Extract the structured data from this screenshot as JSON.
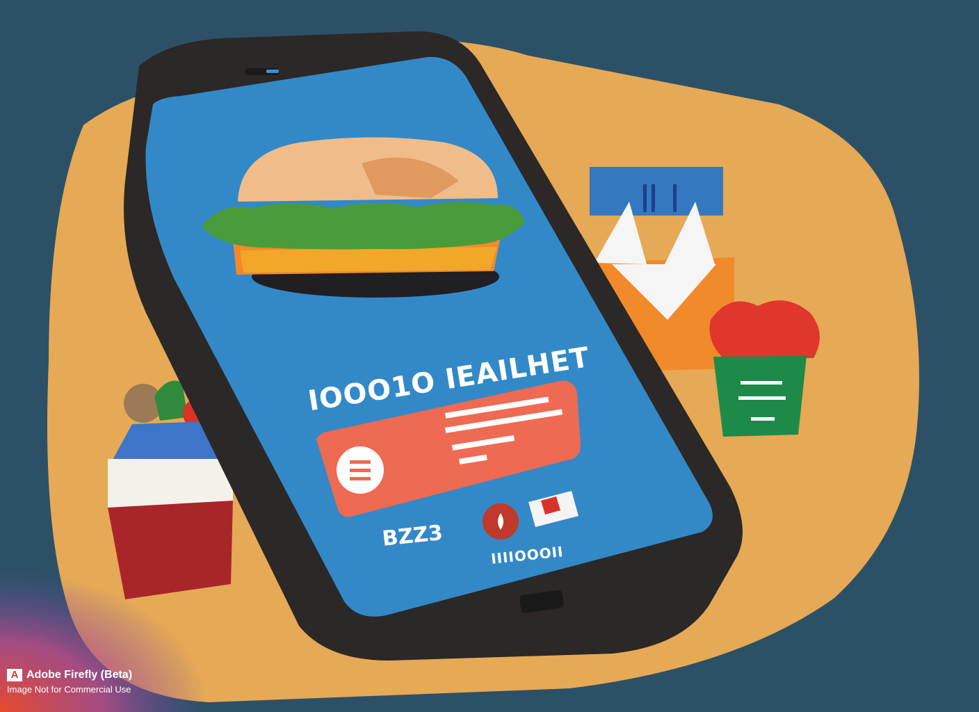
{
  "colors": {
    "background": "#2c5166",
    "table": "#e6a955",
    "phone_body": "#2b2827",
    "screen": "#3389c7",
    "order_card": "#ee6a52",
    "bun": "#f0bd8a",
    "lettuce": "#4a9c3a",
    "orange_bag": "#f08a2a",
    "green_box": "#1d8a4a",
    "red_box": "#a8262a"
  },
  "screen": {
    "headline": "IOOO1O  IEAILHET",
    "price_text": "BZZ3",
    "footer_code": "IIIIOOOII"
  },
  "order_card": {
    "icon": "coin-icon"
  },
  "icons": {
    "pin": "location-pin-icon",
    "flag": "flag-icon",
    "burger": "burger-icon"
  },
  "side_props": {
    "green_box_label_lines": [
      "IIIOOOIII",
      "IIIOOOII",
      "IIIII"
    ]
  },
  "watermark": {
    "brand": "Adobe Firefly (Beta)",
    "note": "Image Not for Commercial Use",
    "logo_letter": "A"
  }
}
